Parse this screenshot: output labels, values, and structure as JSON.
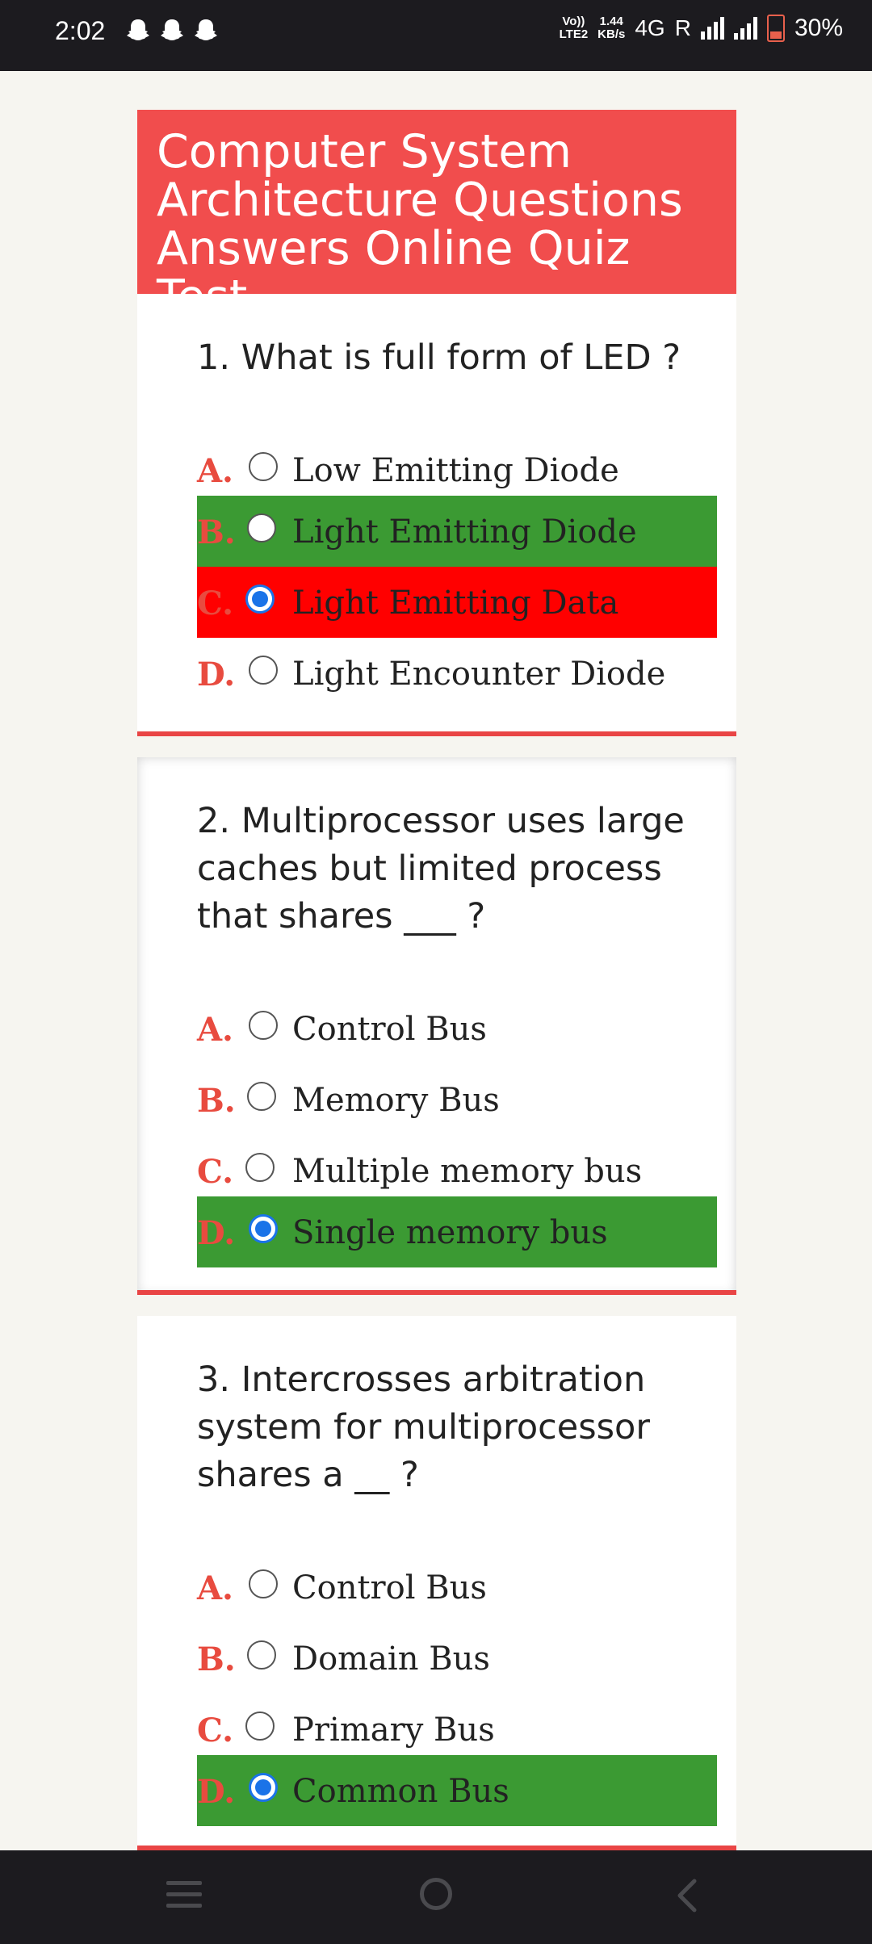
{
  "status_bar": {
    "time": "2:02",
    "net_top": "Vo))",
    "net_bottom": "LTE2",
    "speed_value": "1.44",
    "speed_unit": "KB/s",
    "network": "4G",
    "roaming": "R",
    "battery": "30%"
  },
  "quiz": {
    "title": "Computer System Architecture Questions Answers Online Quiz Test",
    "questions": [
      {
        "text": "1. What is full form of LED ?",
        "options": [
          {
            "letter": "A.",
            "text": "Low Emitting Diode"
          },
          {
            "letter": "B.",
            "text": "Light Emitting Diode"
          },
          {
            "letter": "C.",
            "text": "Light Emitting Data"
          },
          {
            "letter": "D.",
            "text": "Light Encounter Diode"
          }
        ]
      },
      {
        "text": "2. Multiprocessor uses large caches but limited process that shares ___ ?",
        "options": [
          {
            "letter": "A.",
            "text": "Control Bus"
          },
          {
            "letter": "B.",
            "text": "Memory Bus"
          },
          {
            "letter": "C.",
            "text": "Multiple memory bus"
          },
          {
            "letter": "D.",
            "text": "Single memory bus"
          }
        ]
      },
      {
        "text": "3. Intercrosses arbitration system for multiprocessor shares a __ ?",
        "options": [
          {
            "letter": "A.",
            "text": "Control Bus"
          },
          {
            "letter": "B.",
            "text": "Domain Bus"
          },
          {
            "letter": "C.",
            "text": "Primary Bus"
          },
          {
            "letter": "D.",
            "text": "Common Bus"
          }
        ]
      }
    ]
  },
  "colors": {
    "header_bg": "#f14d4d",
    "correct_bg": "#3b9a33",
    "wrong_bg": "#ff0000",
    "radio_checked": "#1a73e8",
    "letter": "#e84b3f"
  }
}
